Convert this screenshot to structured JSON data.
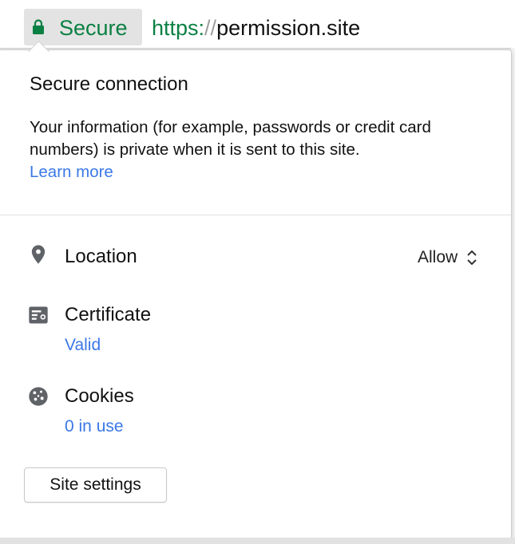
{
  "omnibox": {
    "security_chip_label": "Secure",
    "url_scheme": "https:",
    "url_separator": "//",
    "url_host": "permission.site"
  },
  "popup": {
    "title": "Secure connection",
    "description": "Your information (for example, passwords or credit card numbers) is private when it is sent to this site.",
    "learn_more": "Learn more",
    "location": {
      "label": "Location",
      "value": "Allow",
      "icon": "location-pin-icon"
    },
    "certificate": {
      "label": "Certificate",
      "status": "Valid",
      "icon": "certificate-icon"
    },
    "cookies": {
      "label": "Cookies",
      "status": "0 in use",
      "icon": "cookie-icon"
    },
    "site_settings_button": "Site settings"
  },
  "colors": {
    "secure_green": "#0b8043",
    "link_blue": "#3b78e7",
    "chip_bg": "#e3e3e3"
  }
}
